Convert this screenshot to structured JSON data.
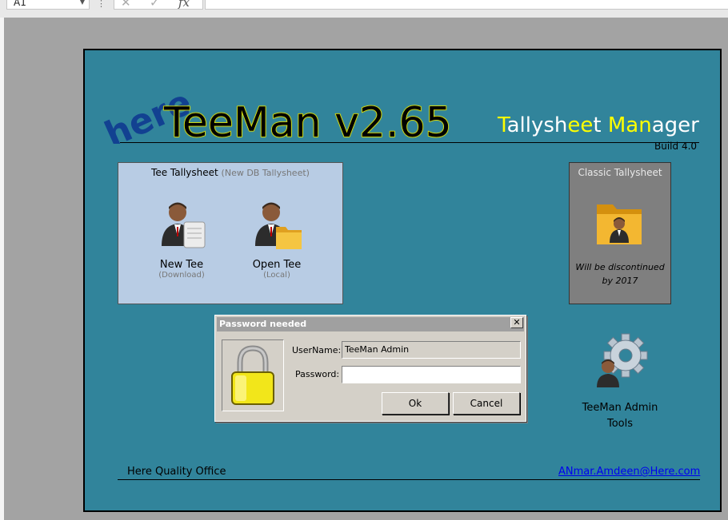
{
  "formula_bar": {
    "name_box": "A1",
    "fx": "fx",
    "cancel_glyph": "✕",
    "enter_glyph": "✓",
    "dots": "⋮"
  },
  "header": {
    "logo": "here",
    "title": "TeeMan v2.65",
    "tagline": {
      "t": "T",
      "ally": "ally",
      "sh": "sh",
      "ee": "ee",
      "t2": "t ",
      "man": "Man",
      "ager": "ager"
    },
    "build": "Build 4.0"
  },
  "tee_box": {
    "title": "Tee Tallysheet",
    "subtitle": "(New DB Tallysheet)",
    "new_tee": {
      "label": "New Tee",
      "sub": "(Download)"
    },
    "open_tee": {
      "label": "Open Tee",
      "sub": "(Local)"
    }
  },
  "classic_box": {
    "title": "Classic Tallysheet",
    "note_line1": "Will be discontinued",
    "note_line2": "by 2017"
  },
  "admin": {
    "line1": "TeeMan Admin",
    "line2": "Tools"
  },
  "footer": {
    "left": "Here Quality Office",
    "email": "ANmar.Amdeen@Here.com"
  },
  "dialog": {
    "title": "Password needed",
    "close": "✕",
    "username_label": "UserName:",
    "username_value": "TeeMan Admin",
    "password_label": "Password:",
    "password_value": "",
    "ok_label": "Ok",
    "cancel_label": "Cancel"
  },
  "colors": {
    "panel": "#31849b",
    "accent": "#ffff00",
    "tee_box": "#b8cce4",
    "classic_box": "#7f7f7f"
  }
}
